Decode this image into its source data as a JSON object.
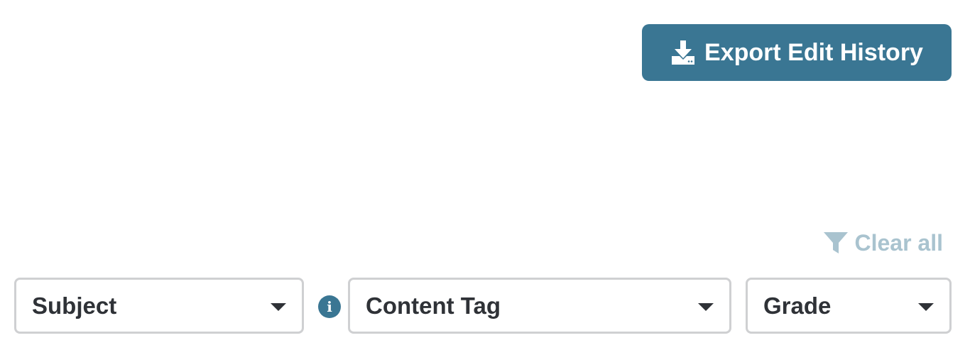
{
  "toolbar": {
    "export_label": "Export Edit History",
    "export_icon": "download-icon",
    "accent_color": "#3a7693"
  },
  "filters": {
    "clear_all_label": "Clear all",
    "clear_all_icon": "filter-icon",
    "clear_all_color": "#a9c3cf",
    "subject_label": "Subject",
    "content_tag_label": "Content Tag",
    "grade_label": "Grade",
    "info_icon": "info-icon"
  }
}
